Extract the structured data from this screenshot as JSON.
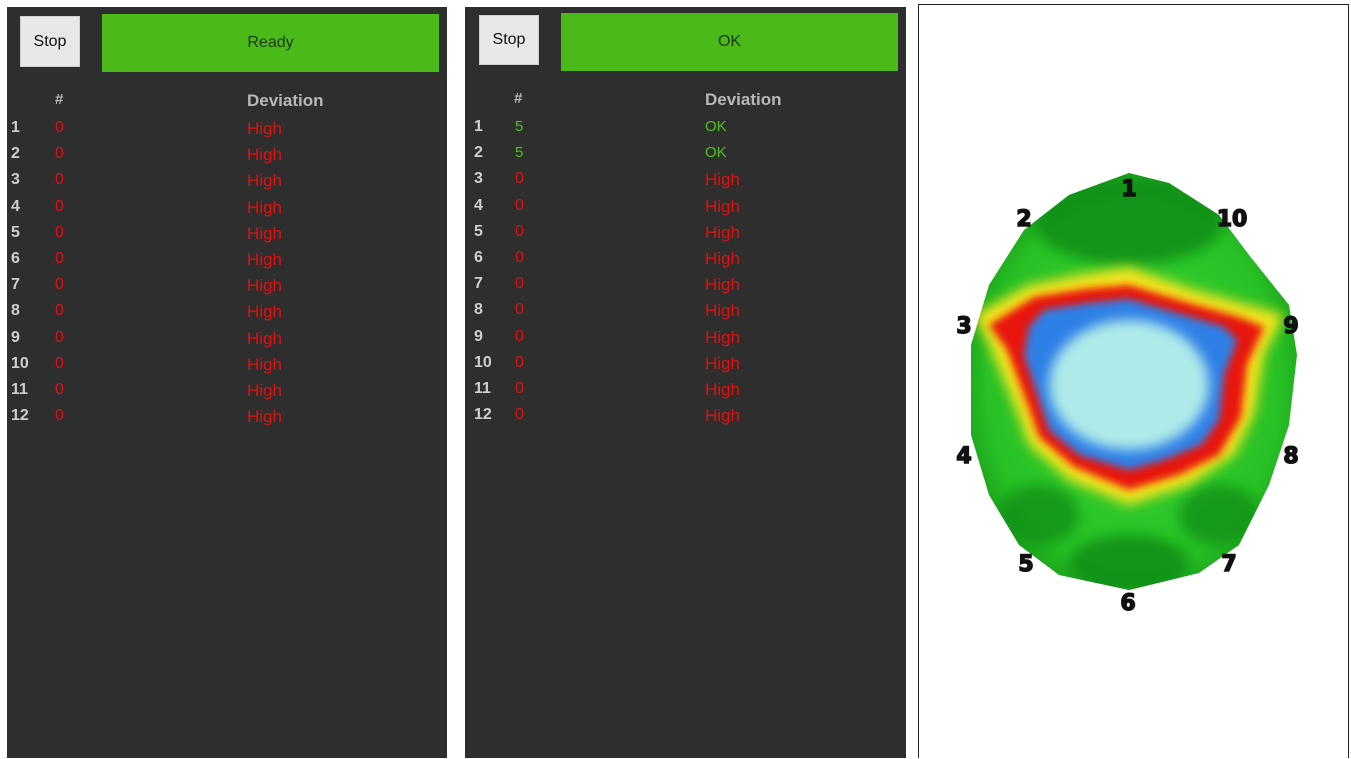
{
  "panel1": {
    "stop_label": "Stop",
    "status": "Ready",
    "status_color": "#4bb919",
    "col_num": "#",
    "col_dev": "Deviation",
    "rows": [
      {
        "idx": "1",
        "val": "0",
        "dev": "High",
        "state": "bad"
      },
      {
        "idx": "2",
        "val": "0",
        "dev": "High",
        "state": "bad"
      },
      {
        "idx": "3",
        "val": "0",
        "dev": "High",
        "state": "bad"
      },
      {
        "idx": "4",
        "val": "0",
        "dev": "High",
        "state": "bad"
      },
      {
        "idx": "5",
        "val": "0",
        "dev": "High",
        "state": "bad"
      },
      {
        "idx": "6",
        "val": "0",
        "dev": "High",
        "state": "bad"
      },
      {
        "idx": "7",
        "val": "0",
        "dev": "High",
        "state": "bad"
      },
      {
        "idx": "8",
        "val": "0",
        "dev": "High",
        "state": "bad"
      },
      {
        "idx": "9",
        "val": "0",
        "dev": "High",
        "state": "bad"
      },
      {
        "idx": "10",
        "val": "0",
        "dev": "High",
        "state": "bad"
      },
      {
        "idx": "11",
        "val": "0",
        "dev": "High",
        "state": "bad"
      },
      {
        "idx": "12",
        "val": "0",
        "dev": "High",
        "state": "bad"
      }
    ]
  },
  "panel2": {
    "stop_label": "Stop",
    "status": "OK",
    "status_color": "#4bb919",
    "col_num": "#",
    "col_dev": "Deviation",
    "rows": [
      {
        "idx": "1",
        "val": "5",
        "dev": "OK",
        "state": "ok"
      },
      {
        "idx": "2",
        "val": "5",
        "dev": "OK",
        "state": "ok"
      },
      {
        "idx": "3",
        "val": "0",
        "dev": "High",
        "state": "bad"
      },
      {
        "idx": "4",
        "val": "0",
        "dev": "High",
        "state": "bad"
      },
      {
        "idx": "5",
        "val": "0",
        "dev": "High",
        "state": "bad"
      },
      {
        "idx": "6",
        "val": "0",
        "dev": "High",
        "state": "bad"
      },
      {
        "idx": "7",
        "val": "0",
        "dev": "High",
        "state": "bad"
      },
      {
        "idx": "8",
        "val": "0",
        "dev": "High",
        "state": "bad"
      },
      {
        "idx": "9",
        "val": "0",
        "dev": "High",
        "state": "bad"
      },
      {
        "idx": "10",
        "val": "0",
        "dev": "High",
        "state": "bad"
      },
      {
        "idx": "11",
        "val": "0",
        "dev": "High",
        "state": "bad"
      },
      {
        "idx": "12",
        "val": "0",
        "dev": "High",
        "state": "bad"
      }
    ]
  },
  "heatmap": {
    "sensor_labels": [
      "1",
      "2",
      "3",
      "4",
      "5",
      "6",
      "7",
      "8",
      "9",
      "10"
    ],
    "colors": {
      "outer": "#129a12",
      "mid": "#2fd42a",
      "warm": "#f7e21c",
      "hot": "#e8150f",
      "cool": "#2f7fe6",
      "core": "#aeeaea"
    }
  }
}
